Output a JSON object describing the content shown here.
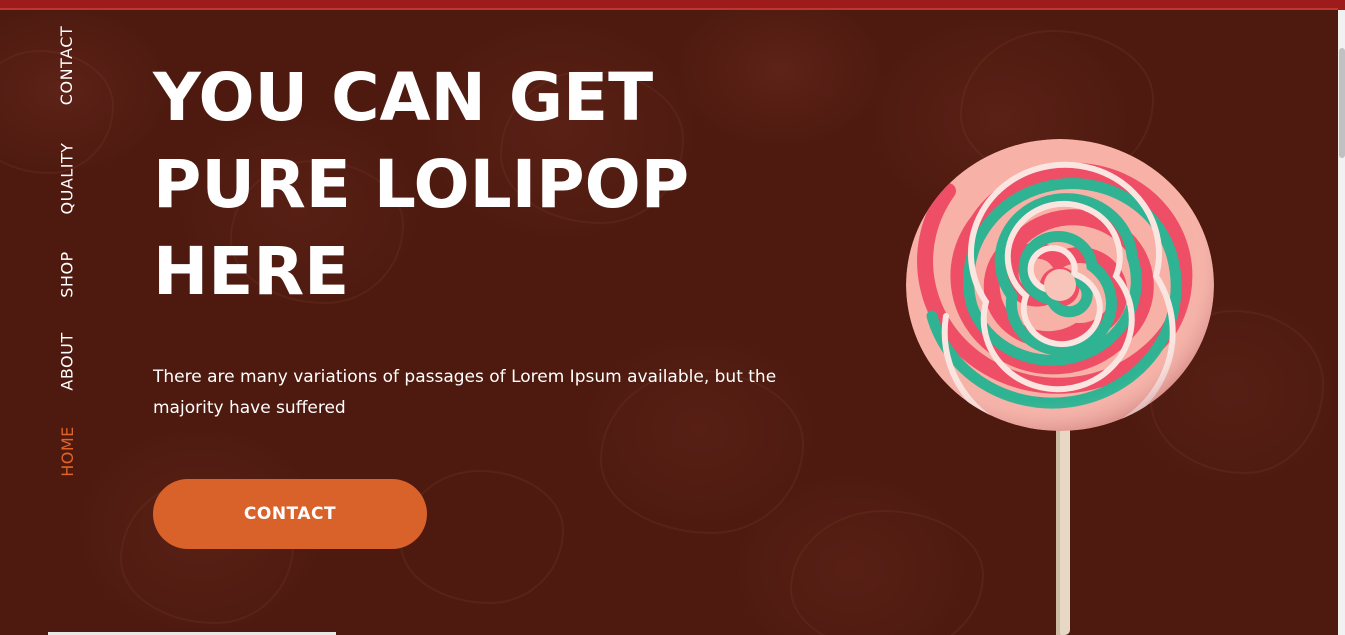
{
  "nav": {
    "items": [
      {
        "label": "CONTACT",
        "active": false
      },
      {
        "label": "QUALITY",
        "active": false
      },
      {
        "label": "SHOP",
        "active": false
      },
      {
        "label": "ABOUT",
        "active": false
      },
      {
        "label": "HOME",
        "active": true
      }
    ]
  },
  "hero": {
    "headline_lines": [
      "YOU CAN GET",
      "PURE LOLIPOP",
      "HERE"
    ],
    "subtext": "There are many variations of passages of Lorem Ipsum available, but the majority have suffered",
    "cta_label": "CONTACT",
    "image": "lollipop-swirl"
  },
  "colors": {
    "background": "#4e1a0f",
    "accent": "#d9612a",
    "active_nav": "#e0632a",
    "top_strip": "#9e1b1b",
    "text": "#ffffff"
  }
}
